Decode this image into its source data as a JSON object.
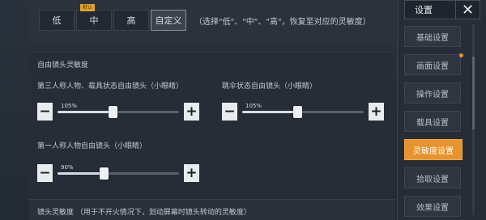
{
  "presets": {
    "low": "低",
    "medium": "中",
    "medium_tag": "默认",
    "high": "高",
    "custom": "自定义",
    "hint": "（选择\"低\"、\"中\"、\"高\"，恢复至对应的灵敏度）"
  },
  "free_look": {
    "title": "自由镜头灵敏度",
    "third_person_label": "第三人称人物、载具状态自由镜头（小眼睛）",
    "parachute_label": "跳伞状态自由镜头（小眼睛）",
    "first_person_label": "第一人称人物自由镜头（小眼睛）",
    "third_person_value": "105%",
    "third_person_level": 0.45,
    "parachute_value": "105%",
    "parachute_level": 0.45,
    "first_person_value": "90%",
    "first_person_level": 0.38
  },
  "bottom": {
    "text": "镜头灵敏度 （用于不开火情况下，划动屏幕时镜头转动的灵敏度）"
  },
  "sidebar": {
    "title": "设置",
    "close": "✕",
    "items": [
      {
        "label": "基础设置"
      },
      {
        "label": "画面设置"
      },
      {
        "label": "操作设置"
      },
      {
        "label": "载具设置"
      },
      {
        "label": "灵敏度设置"
      },
      {
        "label": "拾取设置"
      },
      {
        "label": "效果设置"
      }
    ],
    "accent": "#e8932c"
  }
}
